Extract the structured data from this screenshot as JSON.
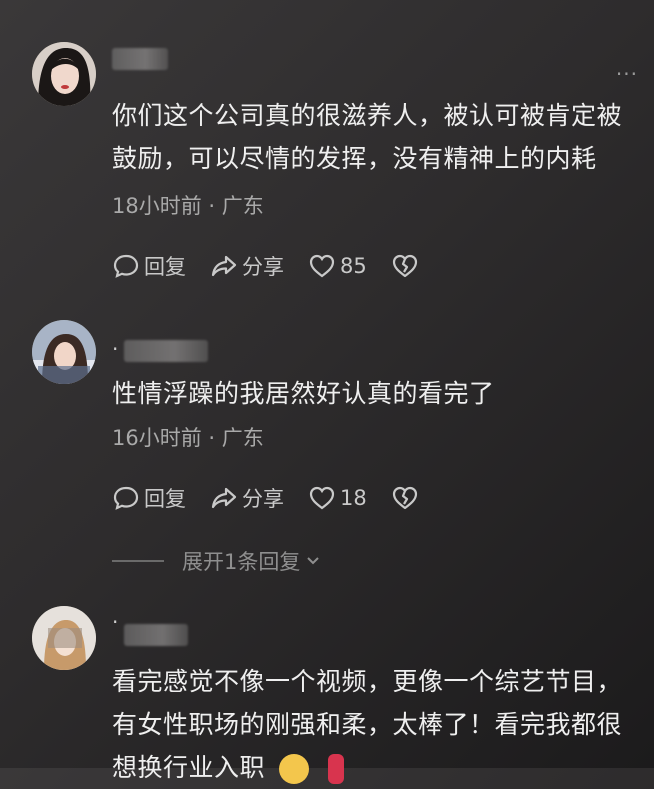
{
  "more_icon_name": "more-dots-icon",
  "comments": [
    {
      "name": "",
      "text_lines": [
        "你们这个公司真的很滋养人，被认可被肯定被",
        "鼓励，可以尽情的发挥，没有精神上的内耗"
      ],
      "meta": "18小时前 · 广东",
      "reply_label": "回复",
      "share_label": "分享",
      "likes": "85"
    },
    {
      "name": "·",
      "text_lines": [
        "性情浮躁的我居然好认真的看完了"
      ],
      "meta": "16小时前 · 广东",
      "reply_label": "回复",
      "share_label": "分享",
      "likes": "18"
    },
    {
      "name": "·",
      "text_lines": [
        "看完感觉不像一个视频，更像一个综艺节目，",
        "有女性职场的刚强和柔，太棒了！看完我都很",
        "想换行业入职"
      ]
    }
  ],
  "expand_replies": "展开1条回复",
  "colors": {
    "background": "#2e2c2d",
    "text": "#efefef",
    "meta": "#a9a9a9"
  }
}
